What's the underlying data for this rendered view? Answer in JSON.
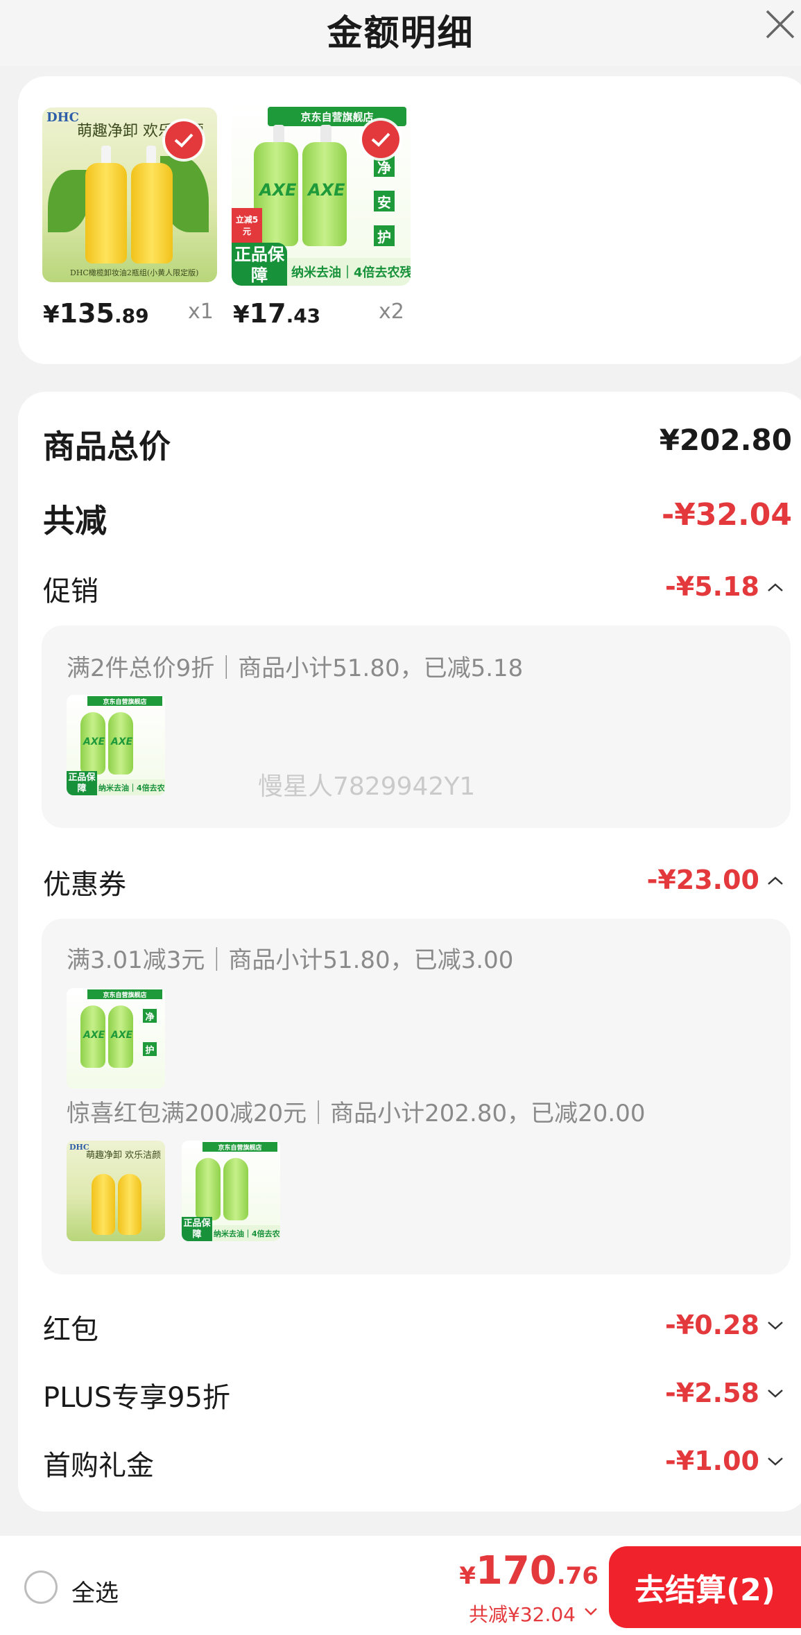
{
  "sheet": {
    "title": "金额明细"
  },
  "products": [
    {
      "price_currency": "¥",
      "price_int": "135",
      "price_dec": ".89",
      "qty": "x1",
      "thumb": {
        "brand": "DHC",
        "slogan": "萌趣净卸 欢乐洁颜",
        "caption": "DHC橄榄卸妆油2瓶组(小黄人限定版)"
      }
    },
    {
      "price_currency": "¥",
      "price_int": "17",
      "price_dec": ".43",
      "qty": "x2",
      "thumb": {
        "brand": "AXE",
        "store": "京东自营旗舰店",
        "guarantee": "正品保障",
        "feature1": "纳米去油",
        "feature2": "4倍去农残",
        "side": [
          "净",
          "安",
          "护"
        ],
        "badge": "立减5元"
      }
    }
  ],
  "summary": {
    "total_label": "商品总价",
    "total_value": "¥202.80",
    "reduce_label": "共减",
    "reduce_value": "-¥32.04"
  },
  "promotion": {
    "label": "促销",
    "value": "-¥5.18",
    "items": [
      {
        "text": "满2件总价9折｜商品小计51.80，已减5.18"
      }
    ]
  },
  "coupon": {
    "label": "优惠券",
    "value": "-¥23.00",
    "items": [
      {
        "text": "满3.01减3元｜商品小计51.80，已减3.00"
      },
      {
        "text": "惊喜红包满200减20元｜商品小计202.80，已减20.00"
      }
    ]
  },
  "redpacket": {
    "label": "红包",
    "value": "-¥0.28"
  },
  "plus": {
    "label": "PLUS专享95折",
    "value": "-¥2.58"
  },
  "firstbuy": {
    "label": "首购礼金",
    "value": "-¥1.00"
  },
  "watermark": "慢星人7829942Y1",
  "footer": {
    "select_all": "全选",
    "total_currency": "¥",
    "total_int": "170",
    "total_dec": ".76",
    "saved_text": "共减¥32.04",
    "checkout": "去结算(2)"
  },
  "colors": {
    "accent_red": "#e4393c",
    "checkout_red": "#f0222c",
    "axe_green": "#1e9a3a"
  },
  "icons": [
    "close-icon",
    "check-icon",
    "chevron-up-icon",
    "chevron-down-icon"
  ]
}
